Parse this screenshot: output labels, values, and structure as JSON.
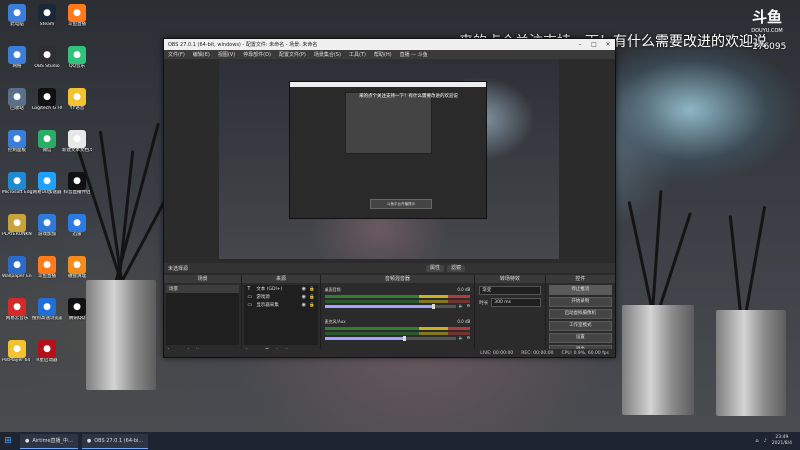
{
  "overlay": {
    "text": "来的点个关注支持一下！有什么需要改进的欢迎说",
    "number": "176095",
    "logo": "斗鱼",
    "logo_sub": "DOUYU.COM"
  },
  "desktop_icons": [
    {
      "label": "此电脑",
      "icon": "computer-icon",
      "color": "#3b7dd8"
    },
    {
      "label": "Steam",
      "icon": "steam-icon",
      "color": "#1b2838"
    },
    {
      "label": "斗鱼直播",
      "icon": "douyu-icon",
      "color": "#ff7a1a"
    },
    {
      "label": "网络",
      "icon": "network-icon",
      "color": "#3b7dd8"
    },
    {
      "label": "OBS Studio",
      "icon": "obs-icon",
      "color": "#302e31"
    },
    {
      "label": "QQ音乐",
      "icon": "qqmusic-icon",
      "color": "#31c27c"
    },
    {
      "label": "回收站",
      "icon": "recycle-bin-icon",
      "color": "#5a6f8a"
    },
    {
      "label": "Logitech G HUB",
      "icon": "ghub-icon",
      "color": "#111"
    },
    {
      "label": "YY语音",
      "icon": "yy-icon",
      "color": "#f2c230"
    },
    {
      "label": "控制面板",
      "icon": "control-panel-icon",
      "color": "#3b7dd8"
    },
    {
      "label": "微信",
      "icon": "wechat-icon",
      "color": "#2aae67"
    },
    {
      "label": "新建文本文档.txt",
      "icon": "text-file-icon",
      "color": "#e8e8e8"
    },
    {
      "label": "Microsoft Edge",
      "icon": "edge-icon",
      "color": "#1f8ad2"
    },
    {
      "label": "网易UU加速器",
      "icon": "uu-icon",
      "color": "#1fa2ff"
    },
    {
      "label": "抖音直播伴侣",
      "icon": "tiktok-icon",
      "color": "#111"
    },
    {
      "label": "PLAYERUNKNOWN'S BATTLEGR...",
      "icon": "pubg-icon",
      "color": "#c7a33a"
    },
    {
      "label": "游戏加加",
      "icon": "game-plus-icon",
      "color": "#2f7ad8"
    },
    {
      "label": "迅雷",
      "icon": "thunder-icon",
      "color": "#2c7be5"
    },
    {
      "label": "Wallpaper Engine",
      "icon": "wallpaper-engine-icon",
      "color": "#2a6cc8"
    },
    {
      "label": "斗鱼直播",
      "icon": "douyu-icon",
      "color": "#ff7a1a"
    },
    {
      "label": "磁盘清理",
      "icon": "disk-clean-icon",
      "color": "#f28c1a"
    },
    {
      "label": "网易云音乐",
      "icon": "netease-music-icon",
      "color": "#d42a2a"
    },
    {
      "label": "搜狗高速浏览器",
      "icon": "sogou-icon",
      "color": "#1f6fd6"
    },
    {
      "label": "腾讯QQ",
      "icon": "qq-icon",
      "color": "#111"
    },
    {
      "label": "PotPlayer 64 bit",
      "icon": "potplayer-icon",
      "color": "#f2c230"
    },
    {
      "label": "R星启动器",
      "icon": "rockstar-icon",
      "color": "#b3121b"
    }
  ],
  "obs": {
    "title": "OBS 27.0.1 (64-bit, windows) - 配置文件: 未命名 - 场景: 未命名",
    "menu": [
      "文件(F)",
      "编辑(E)",
      "视图(V)",
      "停靠部件(D)",
      "配置文件(P)",
      "场景集合(S)",
      "工具(T)",
      "帮助(H)",
      "直播 — 斗鱼"
    ],
    "preview_text": "来的点个关注支持一下！有什么需要改进的欢迎说",
    "preview_button": "斗鱼平台开播提示",
    "scene_label": "未选择源",
    "scene_buttons": [
      "属性",
      "滤镜"
    ],
    "docks": {
      "scenes": {
        "title": "场景",
        "items": [
          "场景"
        ]
      },
      "sources": {
        "title": "来源",
        "items": [
          {
            "icon": "T",
            "label": "文本 (GDI+)"
          },
          {
            "icon": "▭",
            "label": "游戏源"
          },
          {
            "icon": "▭",
            "label": "显示器采集"
          }
        ]
      },
      "mixer": {
        "title": "音频混音器",
        "tracks": [
          {
            "name": "桌面音频",
            "db": "0.0 dB",
            "level": 0.82
          },
          {
            "name": "麦克风/Aux",
            "db": "0.0 dB",
            "level": 0.6
          }
        ]
      },
      "transitions": {
        "title": "转场特效",
        "mode": "渐变",
        "duration_label": "时长",
        "duration": "300 ms"
      },
      "controls": {
        "title": "控件",
        "buttons": [
          "停止推流",
          "开始录制",
          "启动虚拟摄像机",
          "工作室模式",
          "设置",
          "退出"
        ]
      }
    },
    "status": {
      "drop": "LIVE: 00:00:00",
      "rec": "REC: 00:00:00",
      "cpu": "CPU: 0.9%, 60.00 fps"
    }
  },
  "taskbar": {
    "tasks": [
      {
        "label": "Airtime直播_中...",
        "icon": "airtime-icon"
      },
      {
        "label": "OBS 27.0.1 (64-bi...",
        "icon": "obs-icon"
      }
    ],
    "time": "23:49",
    "date": "2021/8/4"
  }
}
